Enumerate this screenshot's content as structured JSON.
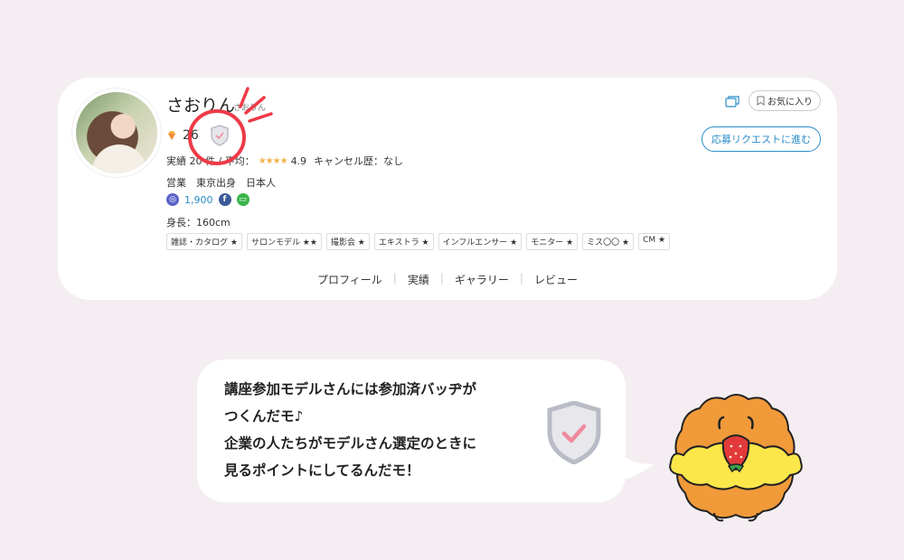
{
  "profile": {
    "name": "さおりん",
    "name_kana": "さおりん",
    "rank_number": "26",
    "stats_prefix": "実績 20 件 / 平均：",
    "stars": "★★★★",
    "rating": "4.9",
    "cancel_history": "キャンセル歴：なし",
    "occupation": "営業　東京出身　日本人",
    "followers": "1,900",
    "height": "身長：160cm",
    "tags": [
      "雑誌・カタログ ★",
      "サロンモデル ★★",
      "撮影会 ★",
      "エキストラ ★",
      "インフルエンサー ★",
      "モニター ★",
      "ミス〇〇 ★",
      "CM ★"
    ]
  },
  "actions": {
    "favorite_label": "お気に入り",
    "apply_label": "応募リクエストに進む"
  },
  "tabs": [
    "プロフィール",
    "実績",
    "ギャラリー",
    "レビュー"
  ],
  "bubble": {
    "line1": "講座参加モデルさんには参加済バッヂが",
    "line2": "つくんだモ♪",
    "line3": "企業の人たちがモデルさん選定のときに",
    "line4": "見るポイントにしてるんだモ！"
  },
  "colors": {
    "background": "#f4eef2",
    "accent_blue": "#2b8cc9",
    "highlight_red": "#ee3a47",
    "star": "#f1b24a"
  },
  "icons": {
    "diamond": "diamond-icon",
    "participation_badge": "shield-check-icon",
    "instagram": "instagram-icon",
    "facebook": "facebook-icon",
    "line": "line-icon",
    "cards": "cards-icon",
    "favorite": "bookmark-icon"
  }
}
